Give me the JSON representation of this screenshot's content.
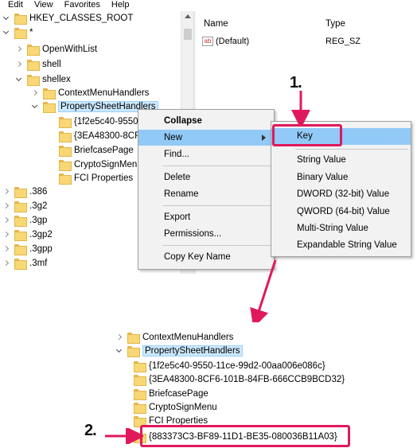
{
  "menubar": {
    "items": [
      "Edit",
      "View",
      "Favorites",
      "Help"
    ]
  },
  "tree": {
    "items": [
      {
        "label": "HKEY_CLASSES_ROOT",
        "expander": "down"
      },
      {
        "label": "*",
        "expander": "down"
      },
      {
        "label": "OpenWithList",
        "expander": "right"
      },
      {
        "label": "shell",
        "expander": "right"
      },
      {
        "label": "shellex",
        "expander": "down"
      },
      {
        "label": "ContextMenuHandlers",
        "expander": "right"
      },
      {
        "label": "PropertySheetHandlers",
        "expander": "down"
      },
      {
        "label": "{1f2e5c40-9550",
        "expander": "none"
      },
      {
        "label": "{3EA48300-8CF",
        "expander": "none"
      },
      {
        "label": "BriefcasePage",
        "expander": "none"
      },
      {
        "label": "CryptoSignMen",
        "expander": "none"
      },
      {
        "label": "FCI Properties",
        "expander": "none"
      },
      {
        "label": ".386",
        "expander": "right"
      },
      {
        "label": ".3g2",
        "expander": "right"
      },
      {
        "label": ".3gp",
        "expander": "right"
      },
      {
        "label": ".3gp2",
        "expander": "right"
      },
      {
        "label": ".3gpp",
        "expander": "right"
      },
      {
        "label": ".3mf",
        "expander": "right"
      }
    ]
  },
  "list": {
    "columns": {
      "name": "Name",
      "type": "Type"
    },
    "rows": [
      {
        "name": "(Default)",
        "type": "REG_SZ",
        "icon": "string-value-icon"
      }
    ]
  },
  "context_menu": {
    "items": [
      "Collapse",
      "New",
      "Find...",
      "Delete",
      "Rename",
      "Export",
      "Permissions...",
      "Copy Key Name"
    ]
  },
  "sub_menu": {
    "items": [
      "Key",
      "String Value",
      "Binary Value",
      "DWORD (32-bit) Value",
      "QWORD (64-bit) Value",
      "Multi-String Value",
      "Expandable String Value"
    ]
  },
  "steps": {
    "one": "1.",
    "two": "2."
  },
  "result_tree": {
    "items": [
      {
        "label": "ContextMenuHandlers",
        "expander": "right"
      },
      {
        "label": "PropertySheetHandlers",
        "expander": "down"
      },
      {
        "label": "{1f2e5c40-9550-11ce-99d2-00aa006e086c}",
        "expander": "none"
      },
      {
        "label": "{3EA48300-8CF6-101B-84FB-666CCB9BCD32}",
        "expander": "none"
      },
      {
        "label": "BriefcasePage",
        "expander": "none"
      },
      {
        "label": "CryptoSignMenu",
        "expander": "none"
      },
      {
        "label": "FCI Properties",
        "expander": "none"
      },
      {
        "label": "{883373C3-BF89-11D1-BE35-080036B11A03}",
        "expander": "none"
      }
    ]
  },
  "colors": {
    "accent_pink": "#e0195c",
    "menu_hover": "#91c9f7",
    "selection": "#cce8ff",
    "folder": "#f8d775"
  }
}
